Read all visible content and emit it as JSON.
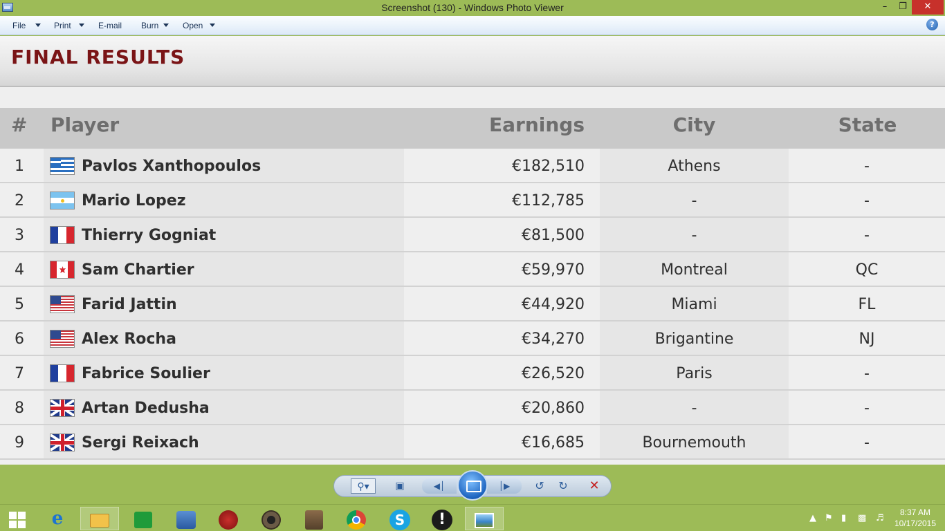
{
  "window": {
    "title": "Screenshot (130) - Windows Photo Viewer"
  },
  "menu": {
    "file": "File",
    "print": "Print",
    "email": "E-mail",
    "burn": "Burn",
    "open": "Open",
    "help": "?"
  },
  "page": {
    "title": "FINAL RESULTS",
    "columns": {
      "rank": "#",
      "player": "Player",
      "earnings": "Earnings",
      "city": "City",
      "state": "State"
    },
    "rows": [
      {
        "rank": "1",
        "flag": "greece",
        "player": "Pavlos Xanthopoulos",
        "earnings": "€182,510",
        "city": "Athens",
        "state": "-"
      },
      {
        "rank": "2",
        "flag": "argentina",
        "player": "Mario Lopez",
        "earnings": "€112,785",
        "city": "-",
        "state": "-"
      },
      {
        "rank": "3",
        "flag": "france",
        "player": "Thierry Gogniat",
        "earnings": "€81,500",
        "city": "-",
        "state": "-"
      },
      {
        "rank": "4",
        "flag": "canada",
        "player": "Sam Chartier",
        "earnings": "€59,970",
        "city": "Montreal",
        "state": "QC"
      },
      {
        "rank": "5",
        "flag": "usa",
        "player": "Farid Jattin",
        "earnings": "€44,920",
        "city": "Miami",
        "state": "FL"
      },
      {
        "rank": "6",
        "flag": "usa",
        "player": "Alex Rocha",
        "earnings": "€34,270",
        "city": "Brigantine",
        "state": "NJ"
      },
      {
        "rank": "7",
        "flag": "france",
        "player": "Fabrice Soulier",
        "earnings": "€26,520",
        "city": "Paris",
        "state": "-"
      },
      {
        "rank": "8",
        "flag": "uk",
        "player": "Artan Dedusha",
        "earnings": "€20,860",
        "city": "-",
        "state": "-"
      },
      {
        "rank": "9",
        "flag": "uk",
        "player": "Sergi Reixach",
        "earnings": "€16,685",
        "city": "Bournemouth",
        "state": "-"
      }
    ]
  },
  "taskbar": {
    "clock_time": "8:37 AM",
    "clock_date": "10/17/2015"
  },
  "colors": {
    "accent": "#9dbb57",
    "title_red": "#7a1416",
    "close_red": "#c7312b"
  },
  "icons": {
    "app": "photo-viewer-icon",
    "start": "windows-logo-icon",
    "ie": "internet-explorer-icon",
    "explorer": "folder-icon",
    "store": "store-icon",
    "chrome": "chrome-icon",
    "skype": "skype-icon"
  }
}
